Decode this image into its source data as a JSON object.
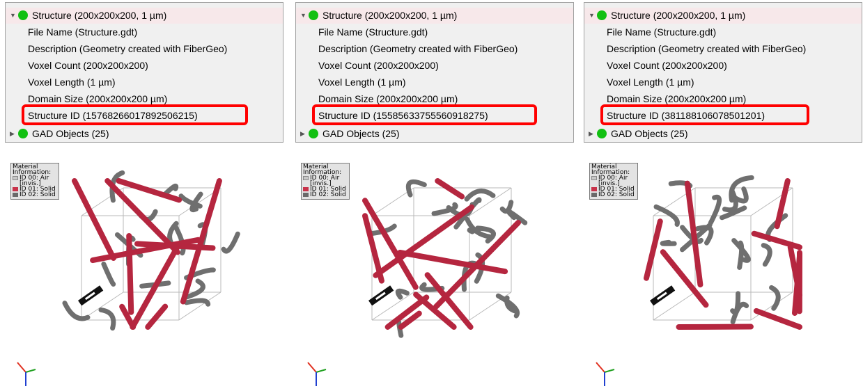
{
  "panels": [
    {
      "header": "Structure (200x200x200, 1 µm)",
      "items": [
        "File Name (Structure.gdt)",
        "Description (Geometry created with FiberGeo)",
        "Voxel Count (200x200x200)",
        "Voxel Length (1 µm)",
        "Domain Size (200x200x200 µm)",
        "Structure ID (15768266017892506215)"
      ],
      "footer": "GAD Objects (25)",
      "legend_title": "Material Information:",
      "legend_items": [
        "ID 00: Air [invis.]",
        "ID 01: Solid",
        "ID 02: Solid"
      ]
    },
    {
      "header": "Structure (200x200x200, 1 µm)",
      "items": [
        "File Name (Structure.gdt)",
        "Description (Geometry created with FiberGeo)",
        "Voxel Count (200x200x200)",
        "Voxel Length (1 µm)",
        "Domain Size (200x200x200 µm)",
        "Structure ID (15585633755560918275)"
      ],
      "footer": "GAD Objects (25)",
      "legend_title": "Material Information:",
      "legend_items": [
        "ID 00: Air [invis.]",
        "ID 01: Solid",
        "ID 02: Solid"
      ]
    },
    {
      "header": "Structure (200x200x200, 1 µm)",
      "items": [
        "File Name (Structure.gdt)",
        "Description (Geometry created with FiberGeo)",
        "Voxel Count (200x200x200)",
        "Voxel Length (1 µm)",
        "Domain Size (200x200x200 µm)",
        "Structure ID (381188106078501201)"
      ],
      "footer": "GAD Objects (25)",
      "legend_title": "Material Information:",
      "legend_items": [
        "ID 00: Air [invis.]",
        "ID 01: Solid",
        "ID 02: Solid"
      ]
    }
  ],
  "colors": {
    "highlight": "#ff0000",
    "status_dot": "#12c012",
    "fiber_red": "#b5263f",
    "fiber_gray": "#6f6f6f",
    "header_bg": "#f7e8ea"
  },
  "icons": [
    "expand-caret-icon",
    "collapse-caret-icon",
    "status-dot-icon",
    "axis-triad-icon",
    "scale-bar-icon"
  ]
}
